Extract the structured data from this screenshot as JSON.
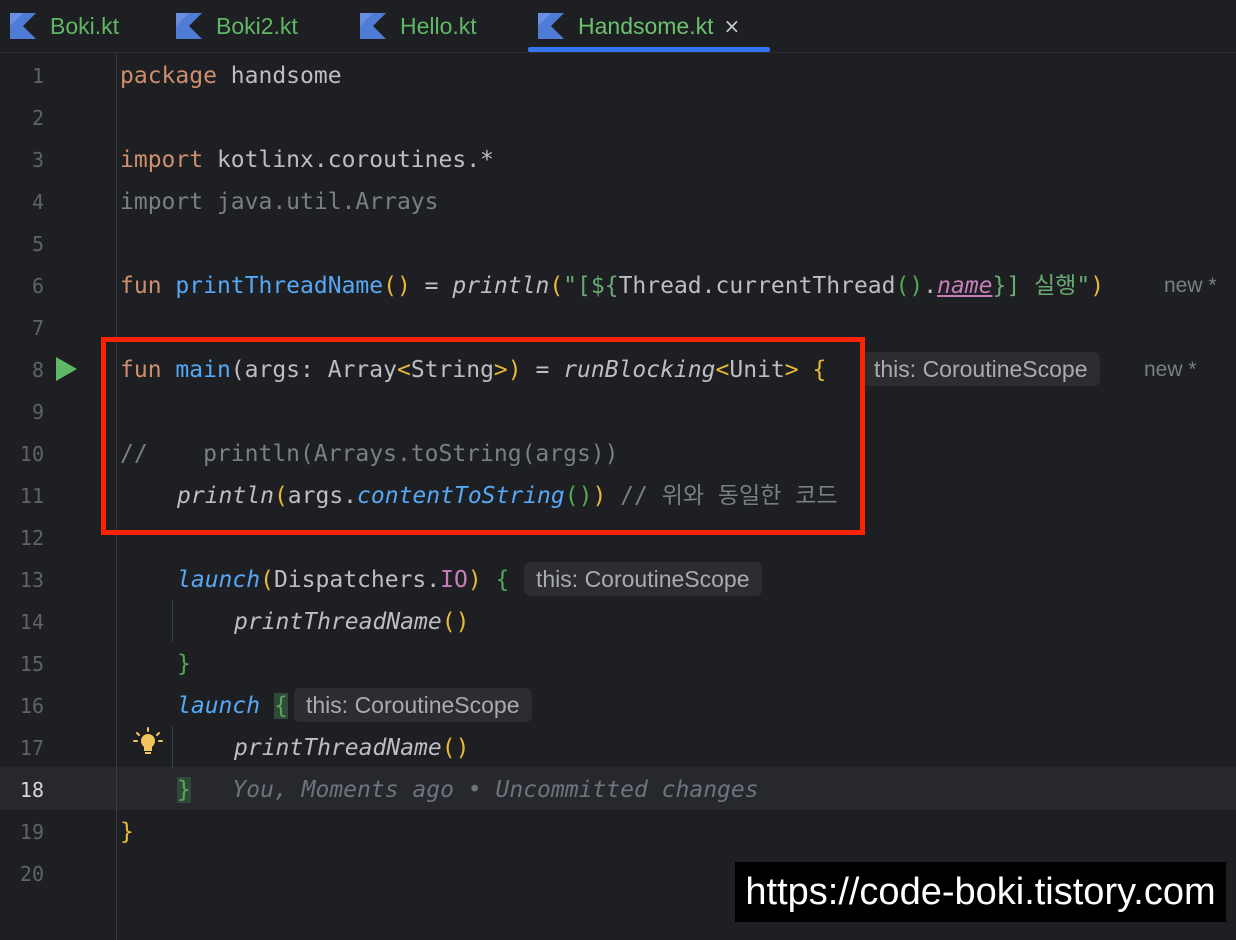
{
  "tabs": [
    {
      "label": "Boki.kt"
    },
    {
      "label": "Boki2.kt"
    },
    {
      "label": "Hello.kt"
    },
    {
      "label": "Handsome.kt",
      "active": true,
      "close": "×"
    }
  ],
  "gutter": {
    "line_numbers": [
      "1",
      "2",
      "3",
      "4",
      "5",
      "6",
      "7",
      "8",
      "9",
      "10",
      "11",
      "12",
      "13",
      "14",
      "15",
      "16",
      "17",
      "18",
      "19",
      "20"
    ],
    "current_line": "18"
  },
  "code": {
    "l1": {
      "kw": "package",
      "rest": " handsome"
    },
    "l3": {
      "kw": "import",
      "rest": " kotlinx.coroutines.*"
    },
    "l4": {
      "text": "import java.util.Arrays"
    },
    "l6": {
      "kw": "fun",
      "fn": "printThreadName",
      "p1": "()",
      "eq": " = ",
      "call": "println",
      "p2": "(",
      "s1": "\"[${",
      "mid": "Thread.currentThread",
      "p3": "()",
      "dot": ".",
      "prop": "name",
      "s2": "}] 실행\"",
      "p4": ")",
      "marker": "new *"
    },
    "l8": {
      "kw": "fun",
      "fn": "main",
      "args": "(args: Array",
      "lt": "<",
      "type": "String",
      "gt": ">",
      "rp": ")",
      "eq": " = ",
      "call": "runBlocking",
      "lt2": "<",
      "type2": "Unit",
      "gt2": ">",
      "brace": " {",
      "hint": "this: CoroutineScope",
      "marker": "new *"
    },
    "l10": {
      "text": "//    println(Arrays.toString(args))"
    },
    "l11": {
      "call": "println",
      "p1": "(",
      "args": "args.",
      "ext": "contentToString",
      "p2": "()",
      "p3": ")",
      "comment": " // 위와 동일한 코드"
    },
    "l13": {
      "call": "launch",
      "p1": "(",
      "disp": "Dispatchers.",
      "io": "IO",
      "p2": ")",
      "brace": " {",
      "hint": "this: CoroutineScope"
    },
    "l14": {
      "call": "printThreadName",
      "p": "()"
    },
    "l15": {
      "brace": "}"
    },
    "l16": {
      "call": "launch",
      "brace": "{",
      "hint": "this: CoroutineScope"
    },
    "l17": {
      "call": "printThreadName",
      "p": "()"
    },
    "l18": {
      "brace": "}",
      "blame": "You, Moments ago • Uncommitted changes"
    },
    "l19": {
      "brace": "}"
    }
  },
  "watermark": "https://code-boki.tistory.com"
}
